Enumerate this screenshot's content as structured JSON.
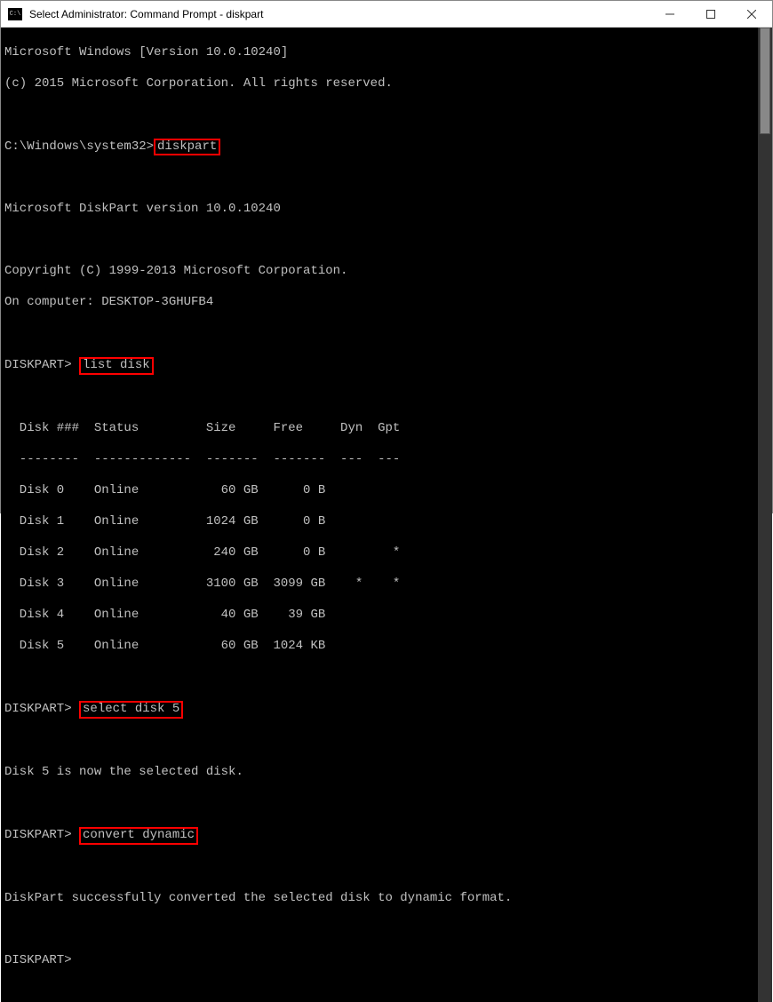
{
  "titlebar": {
    "title": "Select Administrator: Command Prompt - diskpart"
  },
  "terminal": {
    "line1": "Microsoft Windows [Version 10.0.10240]",
    "line2": "(c) 2015 Microsoft Corporation. All rights reserved.",
    "prompt1_prefix": "C:\\Windows\\system32>",
    "cmd1": "diskpart",
    "version_line": "Microsoft DiskPart version 10.0.10240",
    "copyright_line": "Copyright (C) 1999-2013 Microsoft Corporation.",
    "computer_line": "On computer: DESKTOP-3GHUFB4",
    "prompt2_prefix": "DISKPART> ",
    "cmd2": "list disk",
    "table_header": "  Disk ###  Status         Size     Free     Dyn  Gpt",
    "table_divider": "  --------  -------------  -------  -------  ---  ---",
    "disk_rows": [
      "  Disk 0    Online           60 GB      0 B",
      "  Disk 1    Online         1024 GB      0 B",
      "  Disk 2    Online          240 GB      0 B         *",
      "  Disk 3    Online         3100 GB  3099 GB    *    *",
      "  Disk 4    Online           40 GB    39 GB",
      "  Disk 5    Online           60 GB  1024 KB"
    ],
    "prompt3_prefix": "DISKPART> ",
    "cmd3": "select disk 5",
    "select_result": "Disk 5 is now the selected disk.",
    "prompt4_prefix": "DISKPART> ",
    "cmd4": "convert dynamic",
    "convert_result": "DiskPart successfully converted the selected disk to dynamic format.",
    "prompt5": "DISKPART>"
  }
}
